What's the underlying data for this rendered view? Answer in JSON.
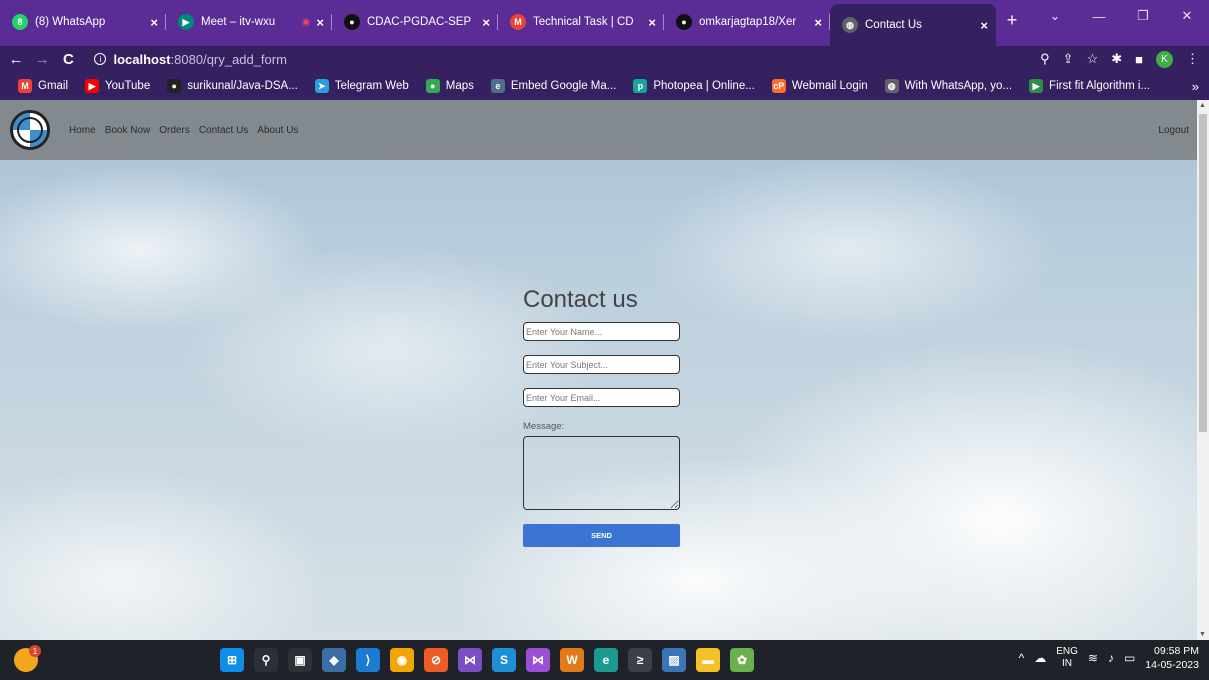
{
  "browser": {
    "tabs": [
      {
        "title": "(8) WhatsApp",
        "icon": "whatsapp-icon",
        "icon_glyph": "8",
        "icon_color": "#25d366",
        "close": "×"
      },
      {
        "title": "Meet – itv-wxu",
        "icon": "meet-icon",
        "icon_glyph": "▶",
        "icon_color": "#00897b",
        "close": "×",
        "record": "◉"
      },
      {
        "title": "CDAC-PGDAC-SEP",
        "icon": "github-icon",
        "icon_glyph": "●",
        "icon_color": "#111111",
        "close": "×"
      },
      {
        "title": "Technical Task | CD",
        "icon": "gmail-icon",
        "icon_glyph": "M",
        "icon_color": "#ea4335",
        "close": "×"
      },
      {
        "title": "omkarjagtap18/Xer",
        "icon": "github-icon",
        "icon_glyph": "●",
        "icon_color": "#111111",
        "close": "×"
      },
      {
        "title": "Contact Us",
        "icon": "globe-icon",
        "icon_glyph": "◍",
        "icon_color": "#5f6368",
        "close": "×",
        "active": true
      }
    ],
    "new_tab": "+",
    "window_controls": {
      "search_tabs": "⌄",
      "minimize": "—",
      "restore": "❐",
      "close": "✕"
    },
    "nav": {
      "back": "←",
      "forward": "→",
      "reload": "C"
    },
    "url": {
      "host": "localhost",
      "path": ":8080/qry_add_form"
    },
    "toolbar_icons": {
      "zoom": "⚲",
      "share": "⇪",
      "star": "☆",
      "extensions": "✱",
      "sidebar": "■",
      "profile": "K",
      "menu": "⋮"
    },
    "bookmarks": [
      {
        "label": "Gmail",
        "icon": "gmail-icon",
        "glyph": "M",
        "color": "#ea4335"
      },
      {
        "label": "YouTube",
        "icon": "youtube-icon",
        "glyph": "▶",
        "color": "#ff0000"
      },
      {
        "label": "surikunal/Java-DSA...",
        "icon": "github-icon",
        "glyph": "●",
        "color": "#222222"
      },
      {
        "label": "Telegram Web",
        "icon": "telegram-icon",
        "glyph": "➤",
        "color": "#2aa0da"
      },
      {
        "label": "Maps",
        "icon": "maps-icon",
        "glyph": "●",
        "color": "#34a853"
      },
      {
        "label": "Embed Google Ma...",
        "icon": "embed-icon",
        "glyph": "e",
        "color": "#4f6e8a"
      },
      {
        "label": "Photopea | Online...",
        "icon": "photopea-icon",
        "glyph": "p",
        "color": "#18a497"
      },
      {
        "label": "Webmail Login",
        "icon": "cpanel-icon",
        "glyph": "cP",
        "color": "#ff6c2c"
      },
      {
        "label": "With WhatsApp, yo...",
        "icon": "globe-icon",
        "glyph": "◍",
        "color": "#5f6368"
      },
      {
        "label": "First fit Algorithm i...",
        "icon": "gfg-icon",
        "glyph": "▶",
        "color": "#2f8d46"
      }
    ],
    "bookmarks_more": "»"
  },
  "site": {
    "nav_links": [
      "Home",
      "Book Now",
      "Orders",
      "Contact Us",
      "About Us"
    ],
    "logout": "Logout"
  },
  "form": {
    "title": "Contact us",
    "name_placeholder": "Enter Your Name...",
    "subject_placeholder": "Enter Your Subject...",
    "email_placeholder": "Enter Your Email...",
    "message_label": "Message:",
    "send_label": "SEND"
  },
  "taskbar": {
    "weather_badge": "1",
    "apps": [
      {
        "name": "windows-start-icon",
        "glyph": "⊞",
        "color": "#0f8ee8"
      },
      {
        "name": "search-icon",
        "glyph": "⚲",
        "color": "#2c3038"
      },
      {
        "name": "task-view-icon",
        "glyph": "▣",
        "color": "#2c3038"
      },
      {
        "name": "git-icon",
        "glyph": "◆",
        "color": "#3a6ea5"
      },
      {
        "name": "vscode-icon",
        "glyph": "⟩",
        "color": "#1b7bd3"
      },
      {
        "name": "chrome-icon",
        "glyph": "◉",
        "color": "#f0a500"
      },
      {
        "name": "postman-icon",
        "glyph": "⊘",
        "color": "#ef5b25"
      },
      {
        "name": "visual-studio-icon",
        "glyph": "⋈",
        "color": "#7b4fc4"
      },
      {
        "name": "skype-icon",
        "glyph": "S",
        "color": "#1c8fd6"
      },
      {
        "name": "visual-studio-2-icon",
        "glyph": "⋈",
        "color": "#9a4fd6"
      },
      {
        "name": "wamp-icon",
        "glyph": "W",
        "color": "#e17a17"
      },
      {
        "name": "edge-icon",
        "glyph": "e",
        "color": "#1c9a8f"
      },
      {
        "name": "terminal-icon",
        "glyph": "≥",
        "color": "#3c4048"
      },
      {
        "name": "image-viewer-icon",
        "glyph": "▨",
        "color": "#3b74b9"
      },
      {
        "name": "file-explorer-icon",
        "glyph": "▬",
        "color": "#f4c126"
      },
      {
        "name": "spring-icon",
        "glyph": "✿",
        "color": "#6ab04c"
      }
    ],
    "tray": {
      "chevron": "^",
      "cloud": "☁",
      "lang_top": "ENG",
      "lang_bottom": "IN",
      "wifi": "≋",
      "sound": "♪",
      "battery": "▭",
      "time": "09:58 PM",
      "date": "14-05-2023"
    }
  }
}
